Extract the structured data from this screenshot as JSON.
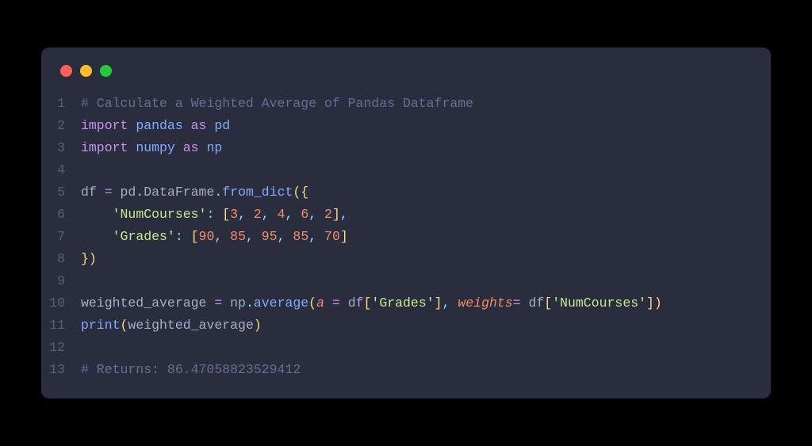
{
  "traffic_colors": {
    "red": "#ff5f56",
    "yellow": "#ffbd2e",
    "green": "#27c93f"
  },
  "code": {
    "lines": [
      {
        "n": "1",
        "tokens": [
          {
            "cls": "c-comment",
            "t": "# Calculate a Weighted Average of Pandas Dataframe"
          }
        ]
      },
      {
        "n": "2",
        "tokens": [
          {
            "cls": "c-keyword",
            "t": "import"
          },
          {
            "cls": "",
            "t": " "
          },
          {
            "cls": "c-module",
            "t": "pandas"
          },
          {
            "cls": "",
            "t": " "
          },
          {
            "cls": "c-keyword",
            "t": "as"
          },
          {
            "cls": "",
            "t": " "
          },
          {
            "cls": "c-module",
            "t": "pd"
          }
        ]
      },
      {
        "n": "3",
        "tokens": [
          {
            "cls": "c-keyword",
            "t": "import"
          },
          {
            "cls": "",
            "t": " "
          },
          {
            "cls": "c-module",
            "t": "numpy"
          },
          {
            "cls": "",
            "t": " "
          },
          {
            "cls": "c-keyword",
            "t": "as"
          },
          {
            "cls": "",
            "t": " "
          },
          {
            "cls": "c-module",
            "t": "np"
          }
        ]
      },
      {
        "n": "4",
        "tokens": []
      },
      {
        "n": "5",
        "tokens": [
          {
            "cls": "c-var",
            "t": "df "
          },
          {
            "cls": "c-assign",
            "t": "="
          },
          {
            "cls": "c-var",
            "t": " pd"
          },
          {
            "cls": "c-punct",
            "t": "."
          },
          {
            "cls": "c-var",
            "t": "DataFrame"
          },
          {
            "cls": "c-punct",
            "t": "."
          },
          {
            "cls": "c-func",
            "t": "from_dict"
          },
          {
            "cls": "c-paren",
            "t": "({"
          }
        ]
      },
      {
        "n": "6",
        "tokens": [
          {
            "cls": "",
            "t": "    "
          },
          {
            "cls": "c-string",
            "t": "'NumCourses'"
          },
          {
            "cls": "c-punct",
            "t": ": "
          },
          {
            "cls": "c-paren",
            "t": "["
          },
          {
            "cls": "c-number",
            "t": "3"
          },
          {
            "cls": "c-punct",
            "t": ", "
          },
          {
            "cls": "c-number",
            "t": "2"
          },
          {
            "cls": "c-punct",
            "t": ", "
          },
          {
            "cls": "c-number",
            "t": "4"
          },
          {
            "cls": "c-punct",
            "t": ", "
          },
          {
            "cls": "c-number",
            "t": "6"
          },
          {
            "cls": "c-punct",
            "t": ", "
          },
          {
            "cls": "c-number",
            "t": "2"
          },
          {
            "cls": "c-paren",
            "t": "]"
          },
          {
            "cls": "c-punct",
            "t": ","
          }
        ]
      },
      {
        "n": "7",
        "tokens": [
          {
            "cls": "",
            "t": "    "
          },
          {
            "cls": "c-string",
            "t": "'Grades'"
          },
          {
            "cls": "c-punct",
            "t": ": "
          },
          {
            "cls": "c-paren",
            "t": "["
          },
          {
            "cls": "c-number",
            "t": "90"
          },
          {
            "cls": "c-punct",
            "t": ", "
          },
          {
            "cls": "c-number",
            "t": "85"
          },
          {
            "cls": "c-punct",
            "t": ", "
          },
          {
            "cls": "c-number",
            "t": "95"
          },
          {
            "cls": "c-punct",
            "t": ", "
          },
          {
            "cls": "c-number",
            "t": "85"
          },
          {
            "cls": "c-punct",
            "t": ", "
          },
          {
            "cls": "c-number",
            "t": "70"
          },
          {
            "cls": "c-paren",
            "t": "]"
          }
        ]
      },
      {
        "n": "8",
        "tokens": [
          {
            "cls": "c-paren",
            "t": "})"
          }
        ]
      },
      {
        "n": "9",
        "tokens": []
      },
      {
        "n": "10",
        "tokens": [
          {
            "cls": "c-var",
            "t": "weighted_average "
          },
          {
            "cls": "c-assign",
            "t": "="
          },
          {
            "cls": "c-var",
            "t": " np"
          },
          {
            "cls": "c-punct",
            "t": "."
          },
          {
            "cls": "c-func",
            "t": "average"
          },
          {
            "cls": "c-paren",
            "t": "("
          },
          {
            "cls": "c-param",
            "t": "a"
          },
          {
            "cls": "c-var",
            "t": " "
          },
          {
            "cls": "c-assign",
            "t": "="
          },
          {
            "cls": "c-var",
            "t": " df"
          },
          {
            "cls": "c-paren",
            "t": "["
          },
          {
            "cls": "c-string",
            "t": "'Grades'"
          },
          {
            "cls": "c-paren",
            "t": "]"
          },
          {
            "cls": "c-punct",
            "t": ", "
          },
          {
            "cls": "c-param",
            "t": "weights"
          },
          {
            "cls": "c-assign",
            "t": "="
          },
          {
            "cls": "c-var",
            "t": " df"
          },
          {
            "cls": "c-paren",
            "t": "["
          },
          {
            "cls": "c-string",
            "t": "'NumCourses'"
          },
          {
            "cls": "c-paren",
            "t": "])"
          }
        ]
      },
      {
        "n": "11",
        "tokens": [
          {
            "cls": "c-builtin",
            "t": "print"
          },
          {
            "cls": "c-paren",
            "t": "("
          },
          {
            "cls": "c-var",
            "t": "weighted_average"
          },
          {
            "cls": "c-paren",
            "t": ")"
          }
        ]
      },
      {
        "n": "12",
        "tokens": []
      },
      {
        "n": "13",
        "tokens": [
          {
            "cls": "c-comment",
            "t": "# Returns: 86.47058823529412"
          }
        ]
      }
    ]
  }
}
